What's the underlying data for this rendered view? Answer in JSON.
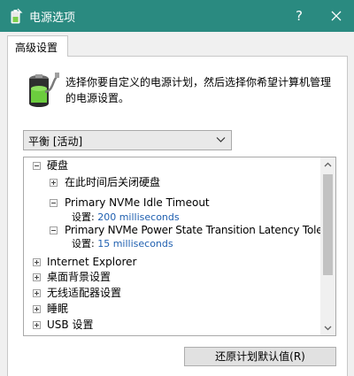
{
  "window": {
    "title": "电源选项",
    "help_label": "?",
    "close_icon": "close-icon"
  },
  "tabs": [
    {
      "label": "高级设置",
      "selected": true
    }
  ],
  "description": "选择你要自定义的电源计划，然后选择你希望计算机管理的电源设置。",
  "plan_select": {
    "value": "平衡 [活动]",
    "icon": "chevron-down-icon"
  },
  "tree": {
    "items": [
      {
        "label": "硬盘",
        "expanded": true,
        "children": [
          {
            "label": "在此时间后关闭硬盘",
            "expanded": false
          },
          {
            "label": "Primary NVMe Idle Timeout",
            "expanded": true,
            "setting_label": "设置:",
            "setting_value": "200 milliseconds"
          },
          {
            "label": "Primary NVMe Power State Transition Latency Tolerance",
            "expanded": true,
            "setting_label": "设置:",
            "setting_value": "15 milliseconds"
          }
        ]
      },
      {
        "label": "Internet Explorer",
        "expanded": false
      },
      {
        "label": "桌面背景设置",
        "expanded": false
      },
      {
        "label": "无线适配器设置",
        "expanded": false
      },
      {
        "label": "睡眠",
        "expanded": false
      },
      {
        "label": "USB 设置",
        "expanded": false
      }
    ]
  },
  "restore_button": "还原计划默认值(R)",
  "colors": {
    "titlebar": "#2a8a80",
    "setting_value": "#2060b0"
  }
}
